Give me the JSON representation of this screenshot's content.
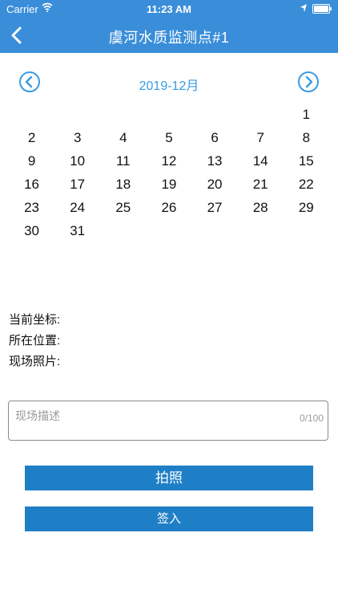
{
  "status_bar": {
    "carrier": "Carrier",
    "time": "11:23 AM"
  },
  "nav": {
    "title": "虞河水质监测点#1",
    "back_icon": "chevron-left-icon"
  },
  "calendar": {
    "month_label": "2019-12月",
    "rows": [
      [
        "",
        "",
        "",
        "",
        "",
        "",
        "1"
      ],
      [
        "2",
        "3",
        "4",
        "5",
        "6",
        "7",
        "8"
      ],
      [
        "9",
        "10",
        "11",
        "12",
        "13",
        "14",
        "15"
      ],
      [
        "16",
        "17",
        "18",
        "19",
        "20",
        "21",
        "22"
      ],
      [
        "23",
        "24",
        "25",
        "26",
        "27",
        "28",
        "29"
      ],
      [
        "30",
        "31",
        "",
        "",
        "",
        "",
        ""
      ]
    ]
  },
  "info": {
    "coordinate_label": "当前坐标:",
    "location_label": "所在位置:",
    "photos_label": "现场照片:"
  },
  "description": {
    "placeholder": "现场描述",
    "counter": "0/100"
  },
  "buttons": {
    "photo": "拍照",
    "checkin": "签入"
  },
  "colors": {
    "header": "#3a8ed9",
    "accent": "#3a9be2",
    "button": "#1f7fc6"
  }
}
